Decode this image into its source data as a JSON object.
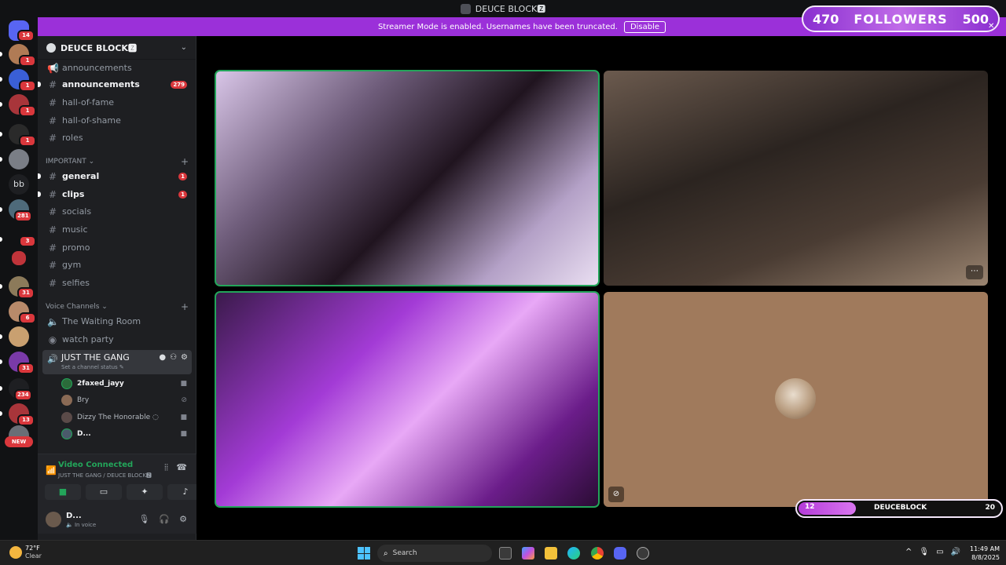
{
  "window": {
    "title": "DEUCE BLOCK🆉"
  },
  "banner": {
    "message": "Streamer Mode is enabled. Usernames have been truncated.",
    "disable_label": "Disable"
  },
  "rail": {
    "badges": [
      "14",
      "1",
      "1",
      "1",
      "1",
      "281",
      "3",
      "31",
      "6",
      "31",
      "234",
      "13"
    ],
    "bb_label": "bb",
    "new_label": "NEW"
  },
  "guild": {
    "name": "DEUCE BLOCK🆉"
  },
  "channels_top": [
    {
      "name": "announcements",
      "icon": "📢",
      "unread": false,
      "badge": ""
    },
    {
      "name": "announcements",
      "icon": "#",
      "unread": true,
      "badge": "279"
    },
    {
      "name": "hall-of-fame",
      "icon": "#",
      "unread": false,
      "badge": ""
    },
    {
      "name": "hall-of-shame",
      "icon": "#",
      "unread": false,
      "badge": ""
    },
    {
      "name": "roles",
      "icon": "#",
      "unread": false,
      "badge": ""
    }
  ],
  "category_important": {
    "label": "IMPORTANT ⌄",
    "plus": "+"
  },
  "channels_important": [
    {
      "name": "general",
      "unread": true,
      "badge": "1"
    },
    {
      "name": "clips",
      "unread": true,
      "badge": "1"
    },
    {
      "name": "socials",
      "unread": false,
      "badge": ""
    },
    {
      "name": "music",
      "unread": false,
      "badge": ""
    },
    {
      "name": "promo",
      "unread": false,
      "badge": ""
    },
    {
      "name": "gym",
      "unread": false,
      "badge": ""
    },
    {
      "name": "selfies",
      "unread": false,
      "badge": ""
    }
  ],
  "category_voice": {
    "label": "Voice Channels ⌄",
    "plus": "+"
  },
  "voice_channels": [
    {
      "name": "The Waiting Room"
    },
    {
      "name": "watch party"
    }
  ],
  "active_voice": {
    "name": "JUST THE GANG",
    "status": "Set a channel status ✎"
  },
  "members": [
    {
      "name": "2faxed_jayy",
      "speaking": true,
      "icon": "■",
      "color": "#2b6b3a"
    },
    {
      "name": "Bry",
      "speaking": false,
      "icon": "⊘",
      "color": "#8a6a55"
    },
    {
      "name": "Dizzy The Honorable ◌",
      "speaking": false,
      "icon": "■",
      "color": "#5a4a48"
    },
    {
      "name": "D...",
      "speaking": true,
      "icon": "■",
      "color": "#4a5a6a"
    }
  ],
  "voice_panel": {
    "title": "Video Connected",
    "subtitle": "JUST THE GANG / DEUCE BLOCK🆉"
  },
  "user_panel": {
    "name": "D...",
    "status": "🔈 In voice"
  },
  "overlay": {
    "followers_current": "470",
    "followers_label": "FOLLOWERS",
    "followers_goal": "500",
    "sub_left": "12",
    "sub_name": "DEUCEBLOCK",
    "sub_right": "20",
    "sub_progress": 0.28
  },
  "taskbar": {
    "temp": "72°F",
    "weather": "Clear",
    "search_label": "Search",
    "time": "11:49 AM",
    "date": "8/8/2025"
  },
  "colors": {
    "accent": "#9b30d9",
    "speaking": "#23a55a",
    "badge": "#da373c"
  }
}
